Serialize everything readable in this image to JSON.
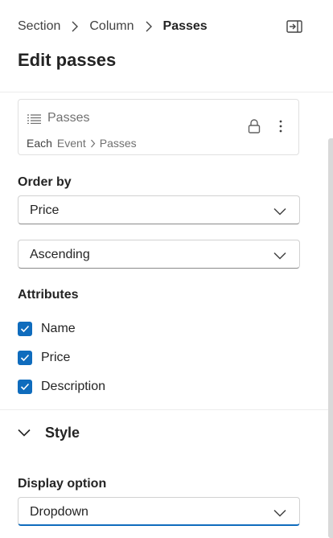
{
  "header": {
    "breadcrumb": [
      "Section",
      "Column",
      "Passes"
    ],
    "title": "Edit passes"
  },
  "source": {
    "name": "Passes",
    "path_prefix": "Each",
    "path": [
      "Event",
      "Passes"
    ]
  },
  "order_by": {
    "label": "Order by",
    "field": "Price",
    "direction": "Ascending"
  },
  "attributes": {
    "label": "Attributes",
    "items": [
      {
        "label": "Name",
        "checked": true
      },
      {
        "label": "Price",
        "checked": true
      },
      {
        "label": "Description",
        "checked": true
      }
    ]
  },
  "style": {
    "label": "Style"
  },
  "display_option": {
    "label": "Display option",
    "value": "Dropdown"
  },
  "colors": {
    "accent": "#0f6cbd"
  }
}
